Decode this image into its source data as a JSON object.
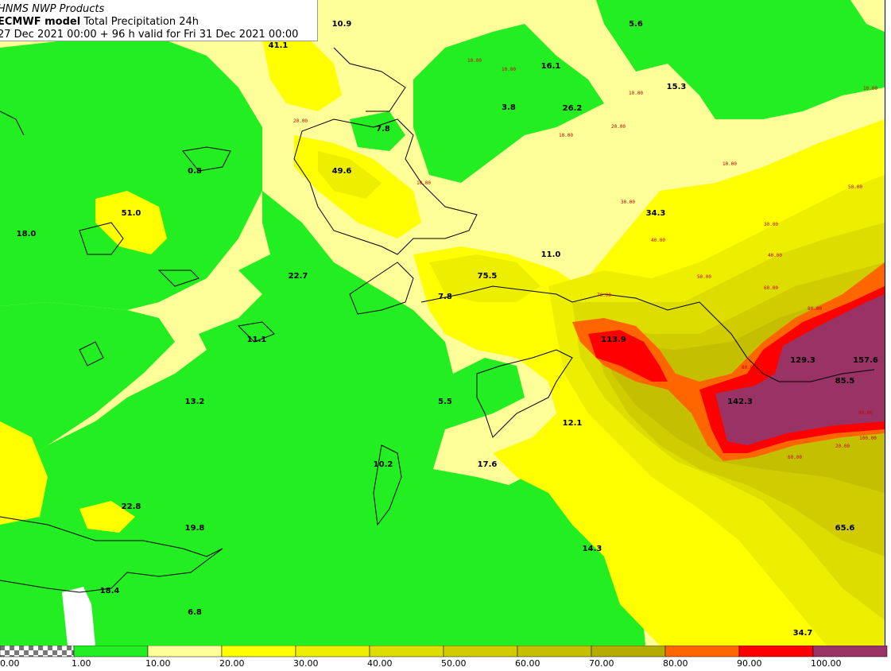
{
  "header": {
    "product": "HNMS NWP Products",
    "model": "ECMWF model",
    "field": "Total Precipitation 24h",
    "valid": "27 Dec 2021 00:00 + 96 h valid for Fri 31 Dec 2021 00:00"
  },
  "colors": {
    "c0": "#ffffff",
    "c1": "#22ee22",
    "c10": "#ffff99",
    "c20": "#ffff00",
    "c30": "#eeee00",
    "c40": "#dddd00",
    "c50": "#d0cc00",
    "c60": "#c4bf00",
    "c70": "#b3ad00",
    "c80": "#ff6600",
    "c90": "#ff0000",
    "c100": "#993366",
    "coast": "#000000"
  },
  "legend": [
    {
      "label": "0.00",
      "color": "checker"
    },
    {
      "label": "1.00",
      "color": "#22ee22"
    },
    {
      "label": "10.00",
      "color": "#ffff99"
    },
    {
      "label": "20.00",
      "color": "#ffff00"
    },
    {
      "label": "30.00",
      "color": "#eeee00"
    },
    {
      "label": "40.00",
      "color": "#dddd00"
    },
    {
      "label": "50.00",
      "color": "#d0cc00"
    },
    {
      "label": "60.00",
      "color": "#c4bf00"
    },
    {
      "label": "70.00",
      "color": "#b3ad00"
    },
    {
      "label": "80.00",
      "color": "#ff6600"
    },
    {
      "label": "90.00",
      "color": "#ff0000"
    },
    {
      "label": "100.00",
      "color": "#993366"
    }
  ],
  "values": [
    {
      "t": "10.9"
    },
    {
      "t": "41.1"
    },
    {
      "t": "5.6"
    },
    {
      "t": "16.1"
    },
    {
      "t": "15.3"
    },
    {
      "t": "3.8"
    },
    {
      "t": "26.2"
    },
    {
      "t": "7.8"
    },
    {
      "t": "49.6"
    },
    {
      "t": "0.8"
    },
    {
      "t": "51.0"
    },
    {
      "t": "18.0"
    },
    {
      "t": "34.3"
    },
    {
      "t": "22.7"
    },
    {
      "t": "75.5"
    },
    {
      "t": "11.0"
    },
    {
      "t": "7.8"
    },
    {
      "t": "11.1"
    },
    {
      "t": "113.9"
    },
    {
      "t": "129.3"
    },
    {
      "t": "157.6"
    },
    {
      "t": "85.5"
    },
    {
      "t": "142.3"
    },
    {
      "t": "13.2"
    },
    {
      "t": "5.5"
    },
    {
      "t": "12.1"
    },
    {
      "t": "10.2"
    },
    {
      "t": "17.6"
    },
    {
      "t": "22.8"
    },
    {
      "t": "19.8"
    },
    {
      "t": "14.3"
    },
    {
      "t": "65.6"
    },
    {
      "t": "18.4"
    },
    {
      "t": "6.8"
    },
    {
      "t": "34.7"
    }
  ],
  "contour_labels": [
    "10.00",
    "20.00",
    "30.00",
    "40.00",
    "50.00",
    "60.00",
    "70.00",
    "80.00",
    "90.00",
    "100.00"
  ]
}
